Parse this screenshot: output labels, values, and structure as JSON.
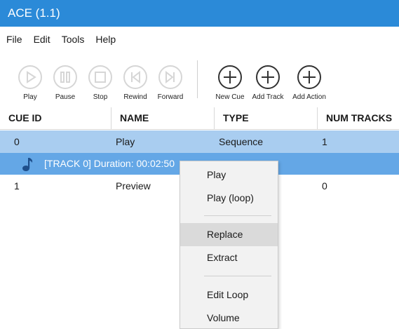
{
  "window": {
    "title": "ACE (1.1)"
  },
  "menubar": {
    "items": [
      {
        "label": "File"
      },
      {
        "label": "Edit"
      },
      {
        "label": "Tools"
      },
      {
        "label": "Help"
      }
    ]
  },
  "toolbar": {
    "play": {
      "label": "Play",
      "icon": "play-icon",
      "enabled": false
    },
    "pause": {
      "label": "Pause",
      "icon": "pause-icon",
      "enabled": false
    },
    "stop": {
      "label": "Stop",
      "icon": "stop-icon",
      "enabled": false
    },
    "rewind": {
      "label": "Rewind",
      "icon": "rewind-icon",
      "enabled": false
    },
    "forward": {
      "label": "Forward",
      "icon": "forward-icon",
      "enabled": false
    },
    "new_cue": {
      "label": "New Cue",
      "icon": "plus-icon",
      "enabled": true
    },
    "add_track": {
      "label": "Add Track",
      "icon": "plus-icon",
      "enabled": true
    },
    "add_action": {
      "label": "Add Action",
      "icon": "plus-icon",
      "enabled": true
    }
  },
  "table": {
    "columns": [
      "CUE ID",
      "NAME",
      "TYPE",
      "NUM TRACKS"
    ],
    "rows": [
      {
        "cue_id": "0",
        "name": "Play",
        "type": "Sequence",
        "num_tracks": "1",
        "selected": true
      },
      {
        "cue_id": "1",
        "name": "Preview",
        "type": "",
        "num_tracks": "0",
        "selected": false
      }
    ],
    "track": {
      "icon": "music-note-icon",
      "label": "[TRACK 0] Duration: 00:02:50"
    }
  },
  "context_menu": {
    "items": [
      {
        "label": "Play"
      },
      {
        "label": "Play (loop)"
      },
      {
        "label": "Replace",
        "highlighted": true
      },
      {
        "label": "Extract"
      },
      {
        "label": "Edit Loop"
      },
      {
        "label": "Volume"
      }
    ]
  },
  "colors": {
    "titlebar": "#2b8ad8",
    "selected_row": "#a9cdf0",
    "track_row": "#64a7e6",
    "menu_background": "#f2f2f2",
    "menu_hover": "#dadada"
  }
}
